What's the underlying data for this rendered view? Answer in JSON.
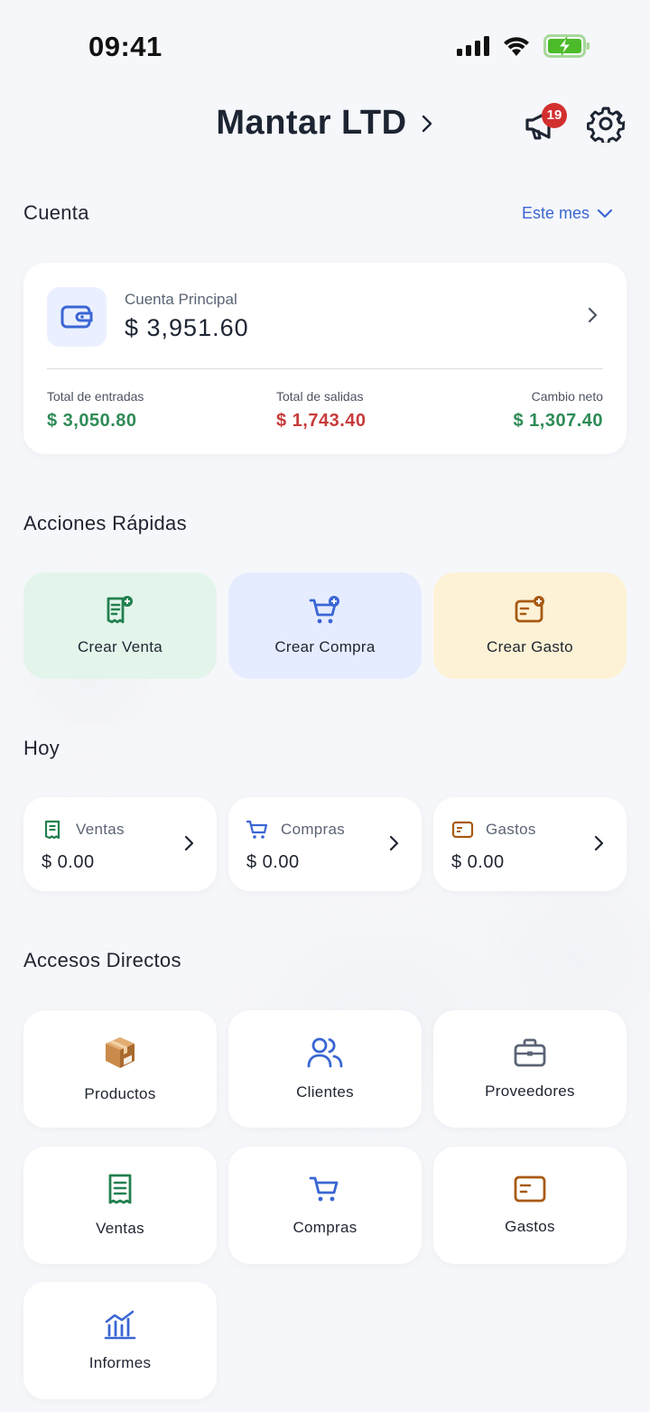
{
  "status_bar": {
    "time": "09:41"
  },
  "header": {
    "company": "Mantar LTD",
    "notification_count": "19"
  },
  "account_section": {
    "title": "Cuenta",
    "period": "Este mes",
    "account_name": "Cuenta Principal",
    "balance": "$ 3,951.60",
    "stats": {
      "in_label": "Total de entradas",
      "in_value": "$ 3,050.80",
      "out_label": "Total de salidas",
      "out_value": "$ 1,743.40",
      "net_label": "Cambio neto",
      "net_value": "$ 1,307.40"
    }
  },
  "quick_actions": {
    "title": "Acciones Rápidas",
    "sale": "Crear Venta",
    "purchase": "Crear Compra",
    "expense": "Crear Gasto"
  },
  "today": {
    "title": "Hoy",
    "sales_label": "Ventas",
    "sales_value": "$ 0.00",
    "purchases_label": "Compras",
    "purchases_value": "$ 0.00",
    "expenses_label": "Gastos",
    "expenses_value": "$ 0.00"
  },
  "shortcuts": {
    "title": "Accesos Directos",
    "products": "Productos",
    "clients": "Clientes",
    "suppliers": "Proveedores",
    "sales": "Ventas",
    "purchases": "Compras",
    "expenses": "Gastos",
    "reports": "Informes"
  },
  "colors": {
    "accent": "#3a66d4",
    "positive": "#2e8b57",
    "negative": "#c83b3b",
    "sale_tile": "#e3f5eb",
    "purchase_tile": "#e6ecff",
    "expense_tile": "#fdf2d6"
  }
}
